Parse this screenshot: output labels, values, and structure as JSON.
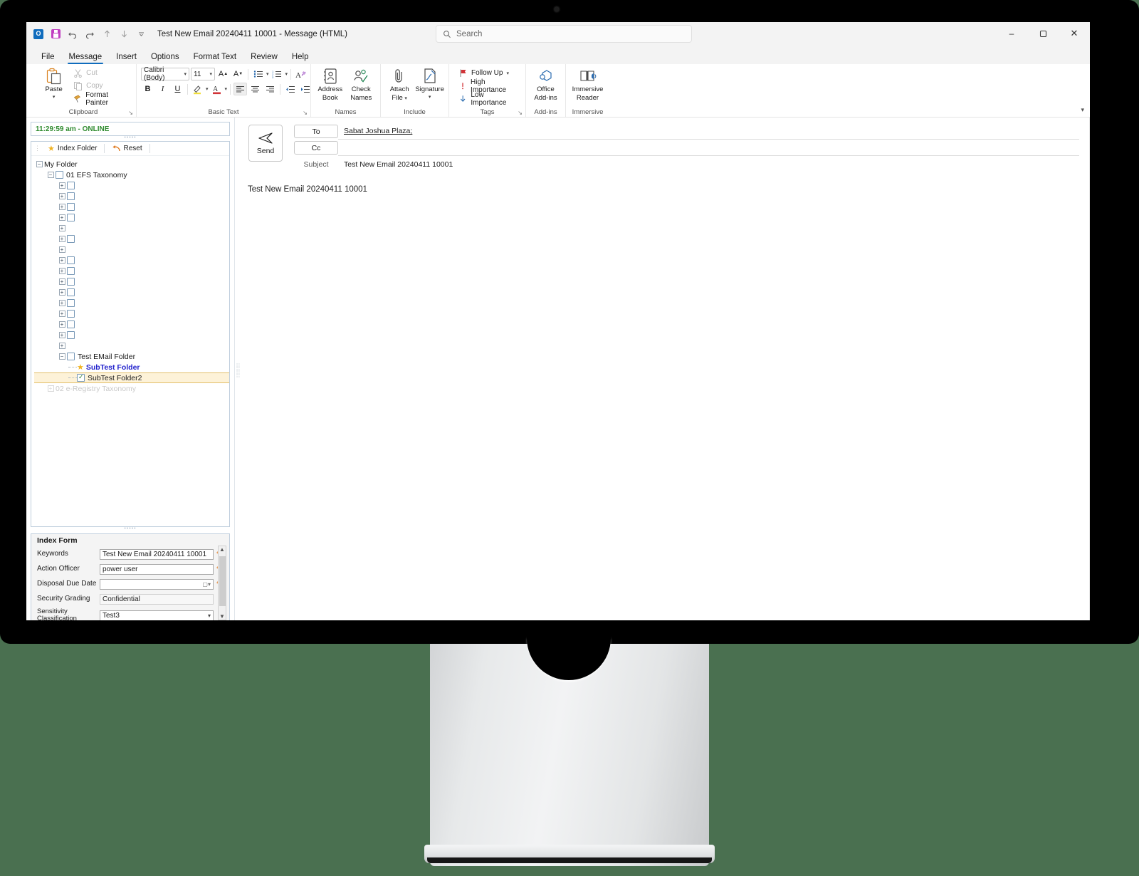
{
  "window": {
    "title": "Test New Email  20240411 10001  -  Message (HTML)",
    "app_icon": "outlook-icon",
    "quick_access": [
      {
        "name": "save-icon",
        "label": "Save"
      },
      {
        "name": "undo-icon",
        "label": "↶"
      },
      {
        "name": "redo-icon",
        "label": "↻"
      },
      {
        "name": "previous-item-icon",
        "label": "↑"
      },
      {
        "name": "next-item-icon",
        "label": "↓"
      },
      {
        "name": "customize-qat-icon",
        "label": "⌄"
      }
    ],
    "controls": {
      "minimize": "–",
      "maximize": "❐",
      "close": "✕"
    }
  },
  "search": {
    "placeholder": "Search",
    "icon": "search-icon"
  },
  "tabs": [
    {
      "label": "File",
      "active": false
    },
    {
      "label": "Message",
      "active": true
    },
    {
      "label": "Insert",
      "active": false
    },
    {
      "label": "Options",
      "active": false
    },
    {
      "label": "Format Text",
      "active": false
    },
    {
      "label": "Review",
      "active": false
    },
    {
      "label": "Help",
      "active": false
    }
  ],
  "ribbon": {
    "collapse_icon": "chevron-down-icon",
    "groups": {
      "clipboard": {
        "label": "Clipboard",
        "paste": "Paste",
        "cut": "Cut",
        "copy": "Copy",
        "format_painter": "Format Painter",
        "dialog_launcher": "↘"
      },
      "basic_text": {
        "label": "Basic Text",
        "font_name": "Calibri (Body)",
        "font_size": "11",
        "grow_font": "A",
        "shrink_font": "A",
        "bullets": "≡",
        "numbering": "≡",
        "clear_formatting": "A",
        "bold": "B",
        "italic": "I",
        "underline": "U",
        "highlight": "✎",
        "font_color": "A",
        "align_left": "≡",
        "align_center": "≡",
        "align_right": "≡",
        "decrease_indent": "←",
        "increase_indent": "→",
        "dialog_launcher": "↘"
      },
      "names": {
        "label": "Names",
        "address_book": "Address\nBook",
        "address_book_l1": "Address",
        "address_book_l2": "Book",
        "check_names_l1": "Check",
        "check_names_l2": "Names"
      },
      "include": {
        "label": "Include",
        "attach_file_l1": "Attach",
        "attach_file_l2": "File",
        "signature_l1": "Signature"
      },
      "tags": {
        "label": "Tags",
        "follow_up": "Follow Up",
        "high_importance": "High Importance",
        "low_importance": "Low Importance",
        "dialog_launcher": "↘"
      },
      "addins": {
        "label": "Add-ins",
        "office_addins_l1": "Office",
        "office_addins_l2": "Add-ins"
      },
      "immersive": {
        "label": "Immersive",
        "immersive_reader_l1": "Immersive",
        "immersive_reader_l2": "Reader"
      }
    }
  },
  "left_panel": {
    "status": "11:29:59 am - ONLINE",
    "status_color": "#2f8b2f",
    "toolbar": {
      "index_folder": "Index Folder",
      "index_folder_icon": "star-icon",
      "reset": "Reset",
      "reset_icon": "undo-arrow-icon"
    },
    "tree": {
      "root": "My Folder",
      "taxonomy": "01 EFS Taxonomy",
      "redacted_label": "",
      "test_email_folder": "Test EMail Folder",
      "subtest_folder": "SubTest Folder",
      "subtest_folder2": "SubTest Folder2",
      "second_taxonomy": "02 e-Registry Taxonomy",
      "blank_rows_count": 16
    },
    "index_form": {
      "title": "Index Form",
      "fields": [
        {
          "label": "Keywords",
          "value": "Test New Email  20240411 10001",
          "required": "*"
        },
        {
          "label": "Action Officer",
          "value": "power  user",
          "required": "*"
        },
        {
          "label": "Disposal Due Date",
          "value": "",
          "required": "* *"
        },
        {
          "label": "Security Grading",
          "value": "Confidential",
          "required": ""
        },
        {
          "label": "Sensitivity Classification",
          "value": "Test3",
          "required": ""
        }
      ]
    }
  },
  "compose": {
    "send_button": "Send",
    "send_icon": "send-arrow-icon",
    "to_button": "To",
    "cc_button": "Cc",
    "to_value": "Sabat Joshua Plaza;",
    "cc_value": "",
    "subject_label": "Subject",
    "subject_value": "Test New Email  20240411 10001",
    "body": "Test New Email  20240411 10001"
  }
}
